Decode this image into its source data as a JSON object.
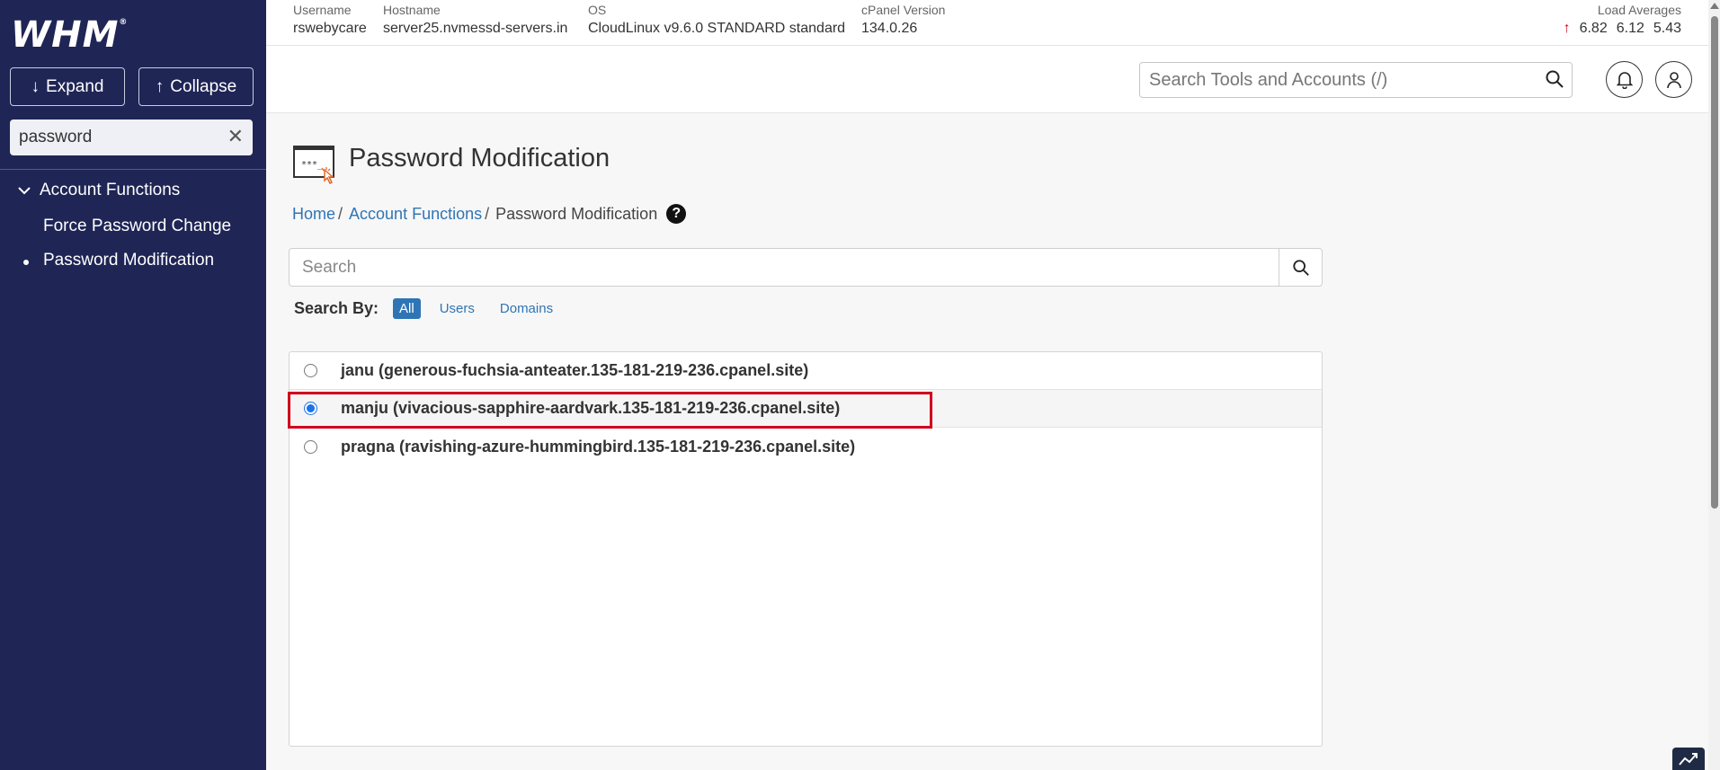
{
  "sidebar": {
    "logo": "WHM",
    "logo_mark": "®",
    "expand_label": "Expand",
    "collapse_label": "Collapse",
    "search_value": "password",
    "category": "Account Functions",
    "items": [
      {
        "label": "Force Password Change"
      },
      {
        "label": "Password Modification"
      }
    ]
  },
  "infobar": {
    "username_label": "Username",
    "username": "rswebycare",
    "hostname_label": "Hostname",
    "hostname": "server25.nvmessd-servers.in",
    "os_label": "OS",
    "os": "CloudLinux v9.6.0 STANDARD standard",
    "cpanel_label": "cPanel Version",
    "cpanel": "134.0.26",
    "load_label": "Load Averages",
    "load": [
      "6.82",
      "6.12",
      "5.43"
    ]
  },
  "header": {
    "search_placeholder": "Search Tools and Accounts (/)"
  },
  "page": {
    "title": "Password Modification",
    "breadcrumb": [
      "Home",
      "Account Functions",
      "Password Modification"
    ],
    "separator": "/",
    "help": "?",
    "search_placeholder": "Search",
    "search_by_label": "Search By:",
    "search_by_options": [
      "All",
      "Users",
      "Domains"
    ],
    "accounts": [
      {
        "label": "janu (generous-fuchsia-anteater.135-181-219-236.cpanel.site)",
        "selected": false
      },
      {
        "label": "manju (vivacious-sapphire-aardvark.135-181-219-236.cpanel.site)",
        "selected": true
      },
      {
        "label": "pragna (ravishing-azure-hummingbird.135-181-219-236.cpanel.site)",
        "selected": false
      }
    ]
  },
  "colors": {
    "sidebar_bg": "#1f2555",
    "link": "#2f75b5",
    "highlight": "#d0021b",
    "radio_selected": "#1a73e8"
  }
}
